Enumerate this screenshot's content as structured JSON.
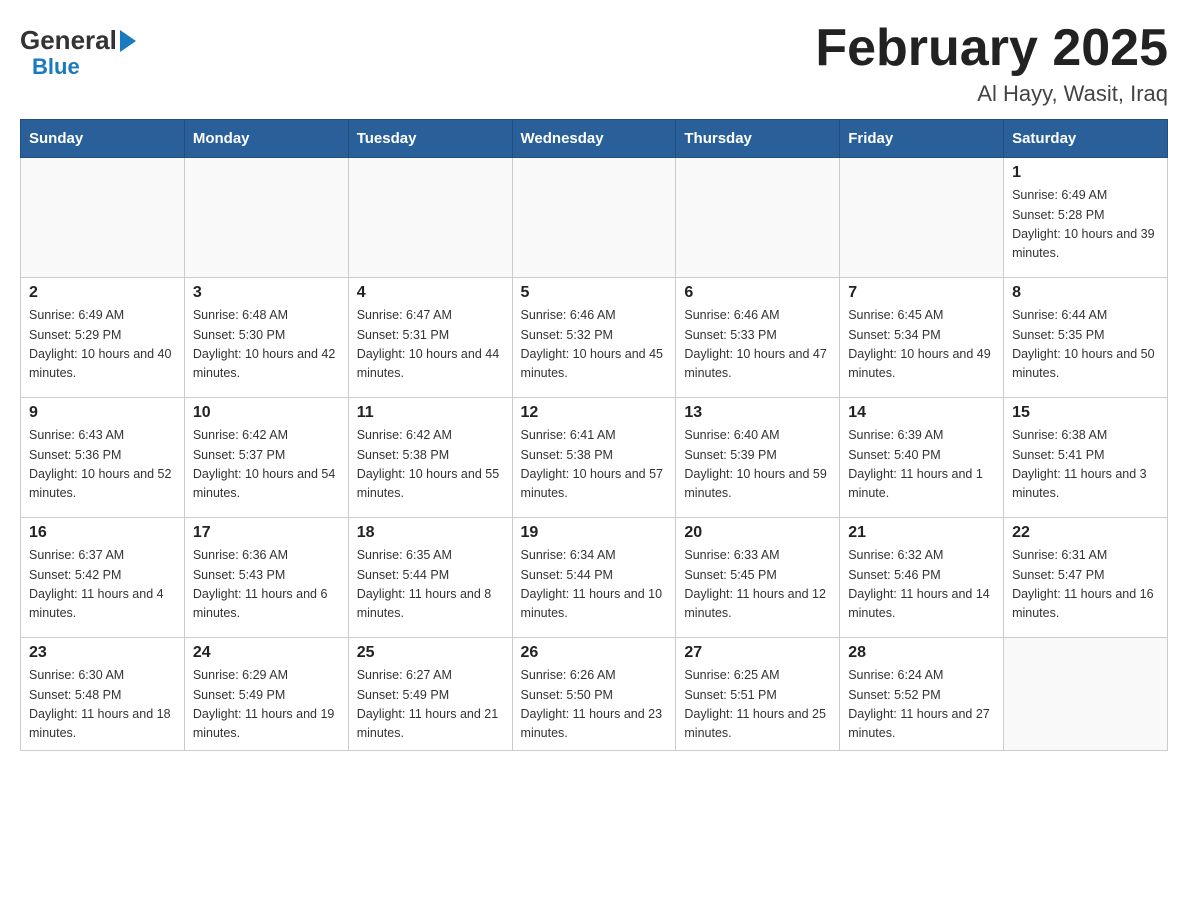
{
  "header": {
    "logo_general": "General",
    "logo_blue": "Blue",
    "month_title": "February 2025",
    "location": "Al Hayy, Wasit, Iraq"
  },
  "weekdays": [
    "Sunday",
    "Monday",
    "Tuesday",
    "Wednesday",
    "Thursday",
    "Friday",
    "Saturday"
  ],
  "weeks": [
    [
      {
        "day": "",
        "sunrise": "",
        "sunset": "",
        "daylight": "",
        "empty": true
      },
      {
        "day": "",
        "sunrise": "",
        "sunset": "",
        "daylight": "",
        "empty": true
      },
      {
        "day": "",
        "sunrise": "",
        "sunset": "",
        "daylight": "",
        "empty": true
      },
      {
        "day": "",
        "sunrise": "",
        "sunset": "",
        "daylight": "",
        "empty": true
      },
      {
        "day": "",
        "sunrise": "",
        "sunset": "",
        "daylight": "",
        "empty": true
      },
      {
        "day": "",
        "sunrise": "",
        "sunset": "",
        "daylight": "",
        "empty": true
      },
      {
        "day": "1",
        "sunrise": "Sunrise: 6:49 AM",
        "sunset": "Sunset: 5:28 PM",
        "daylight": "Daylight: 10 hours and 39 minutes.",
        "empty": false
      }
    ],
    [
      {
        "day": "2",
        "sunrise": "Sunrise: 6:49 AM",
        "sunset": "Sunset: 5:29 PM",
        "daylight": "Daylight: 10 hours and 40 minutes.",
        "empty": false
      },
      {
        "day": "3",
        "sunrise": "Sunrise: 6:48 AM",
        "sunset": "Sunset: 5:30 PM",
        "daylight": "Daylight: 10 hours and 42 minutes.",
        "empty": false
      },
      {
        "day": "4",
        "sunrise": "Sunrise: 6:47 AM",
        "sunset": "Sunset: 5:31 PM",
        "daylight": "Daylight: 10 hours and 44 minutes.",
        "empty": false
      },
      {
        "day": "5",
        "sunrise": "Sunrise: 6:46 AM",
        "sunset": "Sunset: 5:32 PM",
        "daylight": "Daylight: 10 hours and 45 minutes.",
        "empty": false
      },
      {
        "day": "6",
        "sunrise": "Sunrise: 6:46 AM",
        "sunset": "Sunset: 5:33 PM",
        "daylight": "Daylight: 10 hours and 47 minutes.",
        "empty": false
      },
      {
        "day": "7",
        "sunrise": "Sunrise: 6:45 AM",
        "sunset": "Sunset: 5:34 PM",
        "daylight": "Daylight: 10 hours and 49 minutes.",
        "empty": false
      },
      {
        "day": "8",
        "sunrise": "Sunrise: 6:44 AM",
        "sunset": "Sunset: 5:35 PM",
        "daylight": "Daylight: 10 hours and 50 minutes.",
        "empty": false
      }
    ],
    [
      {
        "day": "9",
        "sunrise": "Sunrise: 6:43 AM",
        "sunset": "Sunset: 5:36 PM",
        "daylight": "Daylight: 10 hours and 52 minutes.",
        "empty": false
      },
      {
        "day": "10",
        "sunrise": "Sunrise: 6:42 AM",
        "sunset": "Sunset: 5:37 PM",
        "daylight": "Daylight: 10 hours and 54 minutes.",
        "empty": false
      },
      {
        "day": "11",
        "sunrise": "Sunrise: 6:42 AM",
        "sunset": "Sunset: 5:38 PM",
        "daylight": "Daylight: 10 hours and 55 minutes.",
        "empty": false
      },
      {
        "day": "12",
        "sunrise": "Sunrise: 6:41 AM",
        "sunset": "Sunset: 5:38 PM",
        "daylight": "Daylight: 10 hours and 57 minutes.",
        "empty": false
      },
      {
        "day": "13",
        "sunrise": "Sunrise: 6:40 AM",
        "sunset": "Sunset: 5:39 PM",
        "daylight": "Daylight: 10 hours and 59 minutes.",
        "empty": false
      },
      {
        "day": "14",
        "sunrise": "Sunrise: 6:39 AM",
        "sunset": "Sunset: 5:40 PM",
        "daylight": "Daylight: 11 hours and 1 minute.",
        "empty": false
      },
      {
        "day": "15",
        "sunrise": "Sunrise: 6:38 AM",
        "sunset": "Sunset: 5:41 PM",
        "daylight": "Daylight: 11 hours and 3 minutes.",
        "empty": false
      }
    ],
    [
      {
        "day": "16",
        "sunrise": "Sunrise: 6:37 AM",
        "sunset": "Sunset: 5:42 PM",
        "daylight": "Daylight: 11 hours and 4 minutes.",
        "empty": false
      },
      {
        "day": "17",
        "sunrise": "Sunrise: 6:36 AM",
        "sunset": "Sunset: 5:43 PM",
        "daylight": "Daylight: 11 hours and 6 minutes.",
        "empty": false
      },
      {
        "day": "18",
        "sunrise": "Sunrise: 6:35 AM",
        "sunset": "Sunset: 5:44 PM",
        "daylight": "Daylight: 11 hours and 8 minutes.",
        "empty": false
      },
      {
        "day": "19",
        "sunrise": "Sunrise: 6:34 AM",
        "sunset": "Sunset: 5:44 PM",
        "daylight": "Daylight: 11 hours and 10 minutes.",
        "empty": false
      },
      {
        "day": "20",
        "sunrise": "Sunrise: 6:33 AM",
        "sunset": "Sunset: 5:45 PM",
        "daylight": "Daylight: 11 hours and 12 minutes.",
        "empty": false
      },
      {
        "day": "21",
        "sunrise": "Sunrise: 6:32 AM",
        "sunset": "Sunset: 5:46 PM",
        "daylight": "Daylight: 11 hours and 14 minutes.",
        "empty": false
      },
      {
        "day": "22",
        "sunrise": "Sunrise: 6:31 AM",
        "sunset": "Sunset: 5:47 PM",
        "daylight": "Daylight: 11 hours and 16 minutes.",
        "empty": false
      }
    ],
    [
      {
        "day": "23",
        "sunrise": "Sunrise: 6:30 AM",
        "sunset": "Sunset: 5:48 PM",
        "daylight": "Daylight: 11 hours and 18 minutes.",
        "empty": false
      },
      {
        "day": "24",
        "sunrise": "Sunrise: 6:29 AM",
        "sunset": "Sunset: 5:49 PM",
        "daylight": "Daylight: 11 hours and 19 minutes.",
        "empty": false
      },
      {
        "day": "25",
        "sunrise": "Sunrise: 6:27 AM",
        "sunset": "Sunset: 5:49 PM",
        "daylight": "Daylight: 11 hours and 21 minutes.",
        "empty": false
      },
      {
        "day": "26",
        "sunrise": "Sunrise: 6:26 AM",
        "sunset": "Sunset: 5:50 PM",
        "daylight": "Daylight: 11 hours and 23 minutes.",
        "empty": false
      },
      {
        "day": "27",
        "sunrise": "Sunrise: 6:25 AM",
        "sunset": "Sunset: 5:51 PM",
        "daylight": "Daylight: 11 hours and 25 minutes.",
        "empty": false
      },
      {
        "day": "28",
        "sunrise": "Sunrise: 6:24 AM",
        "sunset": "Sunset: 5:52 PM",
        "daylight": "Daylight: 11 hours and 27 minutes.",
        "empty": false
      },
      {
        "day": "",
        "sunrise": "",
        "sunset": "",
        "daylight": "",
        "empty": true
      }
    ]
  ]
}
